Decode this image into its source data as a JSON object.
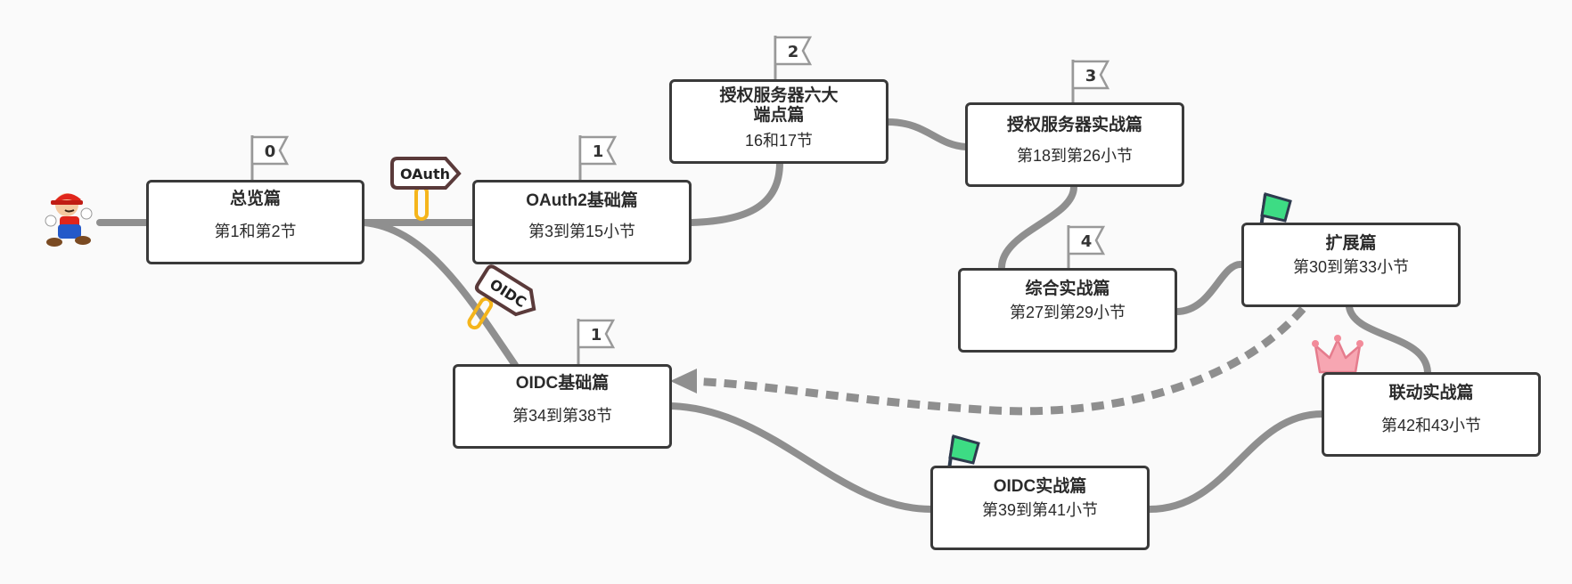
{
  "nodes": {
    "overview": {
      "title": "总览篇",
      "subtitle": "第1和第2节",
      "flag": "0"
    },
    "oauth2_basics": {
      "title": "OAuth2基础篇",
      "subtitle": "第3到第15小节",
      "flag": "1"
    },
    "auth_server_endpoints": {
      "title": "授权服务器六大\n端点篇",
      "subtitle": "16和17节",
      "flag": "2"
    },
    "auth_server_practice": {
      "title": "授权服务器实战篇",
      "subtitle": "第18到第26小节",
      "flag": "3"
    },
    "comprehensive_practice": {
      "title": "综合实战篇",
      "subtitle": "第27到第29小节",
      "flag": "4"
    },
    "extension": {
      "title": "扩展篇",
      "subtitle": "第30到第33小节"
    },
    "oidc_basics": {
      "title": "OIDC基础篇",
      "subtitle": "第34到第38节",
      "flag": "1"
    },
    "oidc_practice": {
      "title": "OIDC实战篇",
      "subtitle": "第39到第41小节"
    },
    "linkage_practice": {
      "title": "联动实战篇",
      "subtitle": "第42和43小节"
    }
  },
  "signs": {
    "oauth": "OAuth",
    "oidc": "OIDC"
  },
  "colors": {
    "connector": "#8f8f8f",
    "node_border": "#3a3a3a",
    "sign_post": "#f5b51b",
    "sign_board": "#5a3a3a",
    "goal_flag": "#3ddc84",
    "crown": "#f28b9a"
  }
}
